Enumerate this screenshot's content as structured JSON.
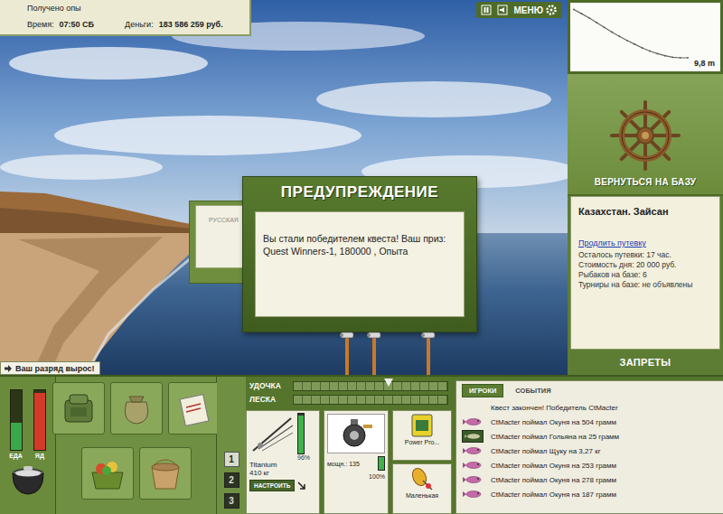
{
  "hud": {
    "notice": "Получено опы",
    "time_label": "Время:",
    "time": "07:50 СБ",
    "money_label": "Деньги:",
    "money": "183 586 259 руб."
  },
  "toolbar": {
    "menu": "МЕНЮ"
  },
  "depth_chart": {
    "reading": "9,8 m",
    "values": [
      0.6,
      1.4,
      2.2,
      3.1,
      4.0,
      4.9,
      5.7,
      6.5,
      7.2,
      7.9,
      8.5,
      9.0,
      9.4,
      9.7,
      9.8,
      9.8
    ]
  },
  "base": {
    "return_label": "ВЕРНУТЬСЯ НА БАЗУ",
    "location": "Казахстан. Зайсан",
    "extend_link": "Продлить путевку",
    "info": [
      "Осталось путевки: 17 час.",
      "Стоимость дня: 20 000 руб.",
      "Рыбаков на базе: 6",
      "Турниры на базе: не объявлены"
    ],
    "bans": "ЗАПРЕТЫ"
  },
  "background_window": {
    "title": "РУССКАЯ"
  },
  "dialog": {
    "title": "ПРЕДУПРЕЖДЕНИЕ",
    "message": "Вы стали победителем квеста! Ваш приз: Quest Winners-1, 180000 , Опыта"
  },
  "rank_badge": {
    "text": "Ваш разряд вырос!"
  },
  "needs": [
    {
      "label": "ЕДА",
      "level": 0.45,
      "color": "#3aa84a"
    },
    {
      "label": "ЯД",
      "level": 0.95,
      "color": "#d23a2a"
    }
  ],
  "rod_slots": [
    {
      "label": "1",
      "selected": true
    },
    {
      "label": "2",
      "selected": false
    },
    {
      "label": "3",
      "selected": false
    }
  ],
  "tension": [
    {
      "label": "УДОЧКА",
      "kind": "marker",
      "level": 0.62
    },
    {
      "label": "ЛЕСКА",
      "kind": "fill",
      "level": 0
    }
  ],
  "tackle": {
    "rod": {
      "condition": "96%",
      "level": 0.96,
      "name": "Titanium",
      "load": "410 кг",
      "button": "НАСТРОИТЬ"
    },
    "reel": {
      "power": "мощн.: 135",
      "condition": "100%",
      "level": 1
    },
    "line": {
      "name": "Power Pro..."
    },
    "lure": {
      "name": "Маленькая"
    }
  },
  "events_panel": {
    "tabs": [
      {
        "label": "ИГРОКИ",
        "selected": true
      },
      {
        "label": "СОБЫТИЯ",
        "selected": false
      }
    ],
    "items": [
      {
        "text": "Квест закончен! Победитель CtMacter",
        "kind": "notice"
      },
      {
        "text": "CtMacter поймал Окуня на 504 грамм",
        "kind": "catch"
      },
      {
        "text": "CtMacter поймал Гольяна на 25 грамм",
        "kind": "featured"
      },
      {
        "text": "CtMacter поймал Щуку на 3,27 кг",
        "kind": "catch"
      },
      {
        "text": "CtMacter поймал Окуня на 253 грамм",
        "kind": "catch"
      },
      {
        "text": "CtMacter поймал Окуня на 278 грамм",
        "kind": "catch"
      },
      {
        "text": "CtMacter поймал Окуня на 187 грамм",
        "kind": "catch"
      }
    ]
  }
}
